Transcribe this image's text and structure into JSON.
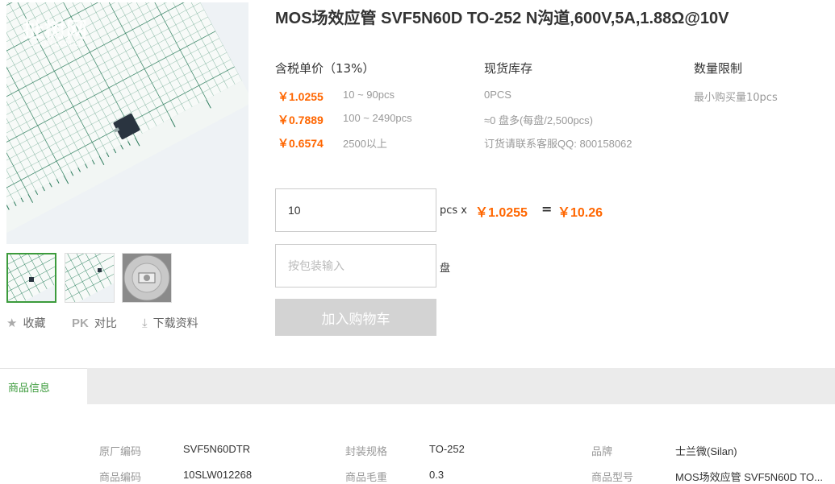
{
  "gallery": {
    "watermark": "扯树网",
    "watermark_sub": "ZOOM.COM.CN",
    "thumbs": [
      "thumbnail-1",
      "thumbnail-2",
      "thumbnail-3"
    ]
  },
  "tools": {
    "favorite_icon": "star-icon",
    "favorite_label": "收藏",
    "pk_icon": "PK",
    "pk_label": "对比",
    "download_icon": "download-icon",
    "download_label": "下载资料"
  },
  "product": {
    "title": "MOS场效应管 SVF5N60D TO-252 N沟道,600V,5A,1.88Ω@10V"
  },
  "pricing": {
    "header": "含税单价（13%）",
    "tiers": [
      {
        "price": "￥1.0255",
        "range": "10 ~ 90pcs"
      },
      {
        "price": "￥0.7889",
        "range": "100 ~ 2490pcs"
      },
      {
        "price": "￥0.6574",
        "range": "2500以上"
      }
    ]
  },
  "stock": {
    "header": "现货库存",
    "lines": [
      "0PCS",
      "≈0 盘多(每盘/2,500pcs)",
      "订货请联系客服QQ: 800158062"
    ]
  },
  "limit": {
    "header": "数量限制",
    "text": "最小购买量10pcs"
  },
  "order": {
    "qty_value": "10",
    "qty_unit": "pcs x",
    "unit_price": "￥1.0255",
    "equals": "=",
    "total": "￥10.26",
    "reel_placeholder": "按包装输入",
    "reel_unit": "盘",
    "add_to_cart": "加入购物车"
  },
  "tabs": {
    "product_info": "商品信息"
  },
  "specs": [
    {
      "key": "原厂编码",
      "value": "SVF5N60DTR"
    },
    {
      "key": "封装规格",
      "value": "TO-252"
    },
    {
      "key": "品牌",
      "value": "士兰微(Silan)"
    },
    {
      "key": "商品编码",
      "value": "10SLW012268"
    },
    {
      "key": "商品毛重",
      "value": "0.3"
    },
    {
      "key": "商品型号",
      "value": "MOS场效应管 SVF5N60D TO..."
    }
  ],
  "colors": {
    "price": "#ff6600",
    "accent_green": "#3c9b3c",
    "button_disabled": "#d3d3d3"
  }
}
